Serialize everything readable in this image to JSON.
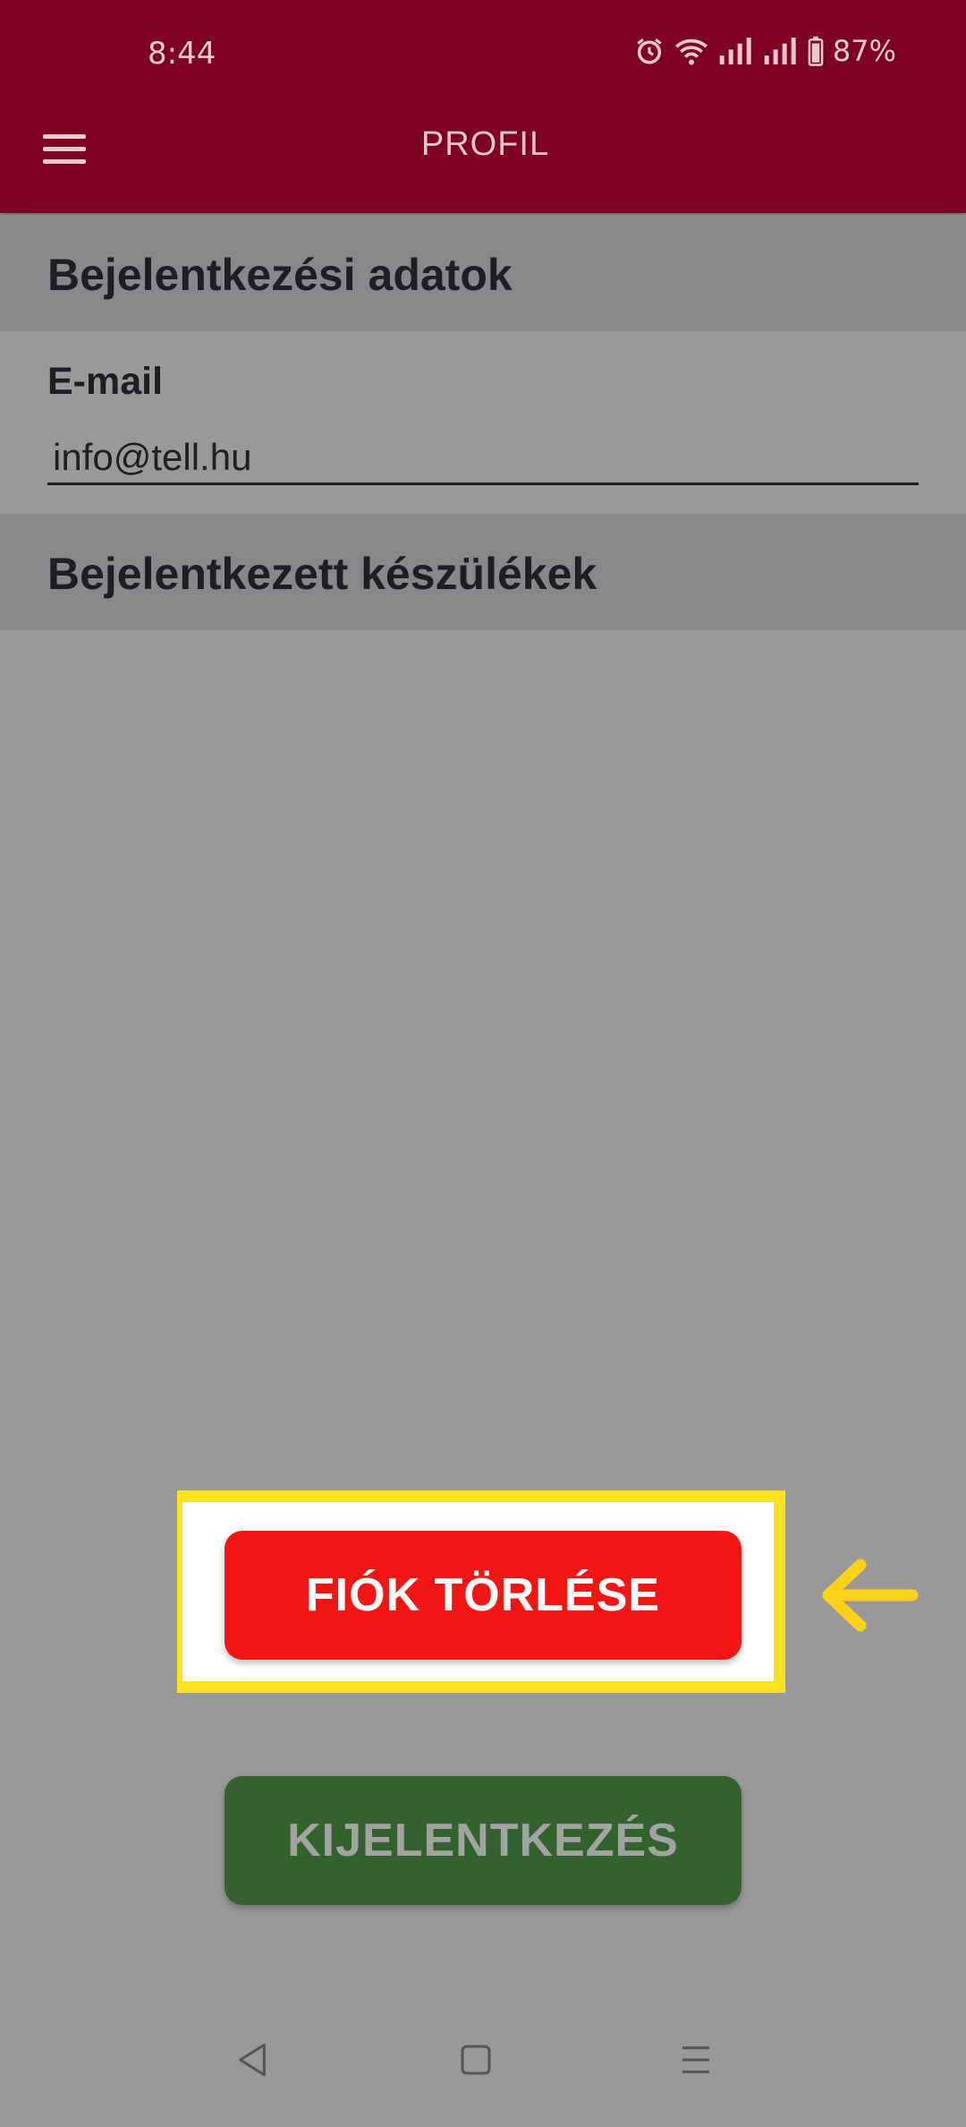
{
  "status_bar": {
    "time": "8:44",
    "battery": "87%",
    "icons": [
      "alarm-icon",
      "wifi-icon",
      "signal-icon",
      "signal-icon",
      "battery-icon"
    ]
  },
  "app_bar": {
    "title": "PROFIL",
    "menu_icon": "hamburger-menu-icon",
    "color": "#7d0020"
  },
  "login_section": {
    "title": "Bejelentkezési adatok",
    "email_label": "E-mail",
    "email_value": "info@tell.hu"
  },
  "devices_section": {
    "title": "Bejelentkezett készülékek"
  },
  "actions": {
    "delete_account": "FIÓK TÖRLÉSE",
    "logout": "KIJELENTKEZÉS",
    "delete_color": "#f21612",
    "logout_color": "#34622e",
    "highlight_color": "#ffe21f"
  },
  "nav_bar": {
    "icons": [
      "back-icon",
      "home-icon",
      "recents-icon"
    ]
  }
}
